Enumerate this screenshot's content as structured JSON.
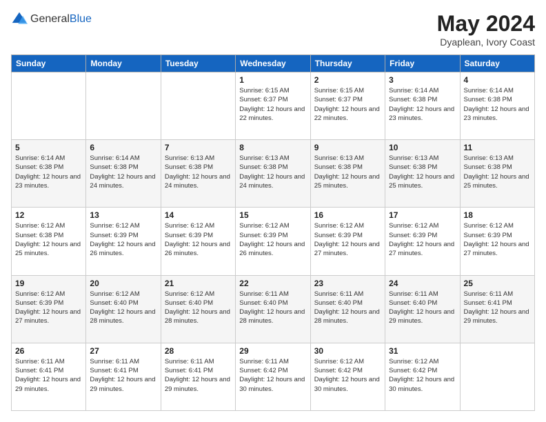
{
  "logo": {
    "general": "General",
    "blue": "Blue"
  },
  "header": {
    "title": "May 2024",
    "subtitle": "Dyaplean, Ivory Coast"
  },
  "weekdays": [
    "Sunday",
    "Monday",
    "Tuesday",
    "Wednesday",
    "Thursday",
    "Friday",
    "Saturday"
  ],
  "weeks": [
    [
      {
        "day": "",
        "info": ""
      },
      {
        "day": "",
        "info": ""
      },
      {
        "day": "",
        "info": ""
      },
      {
        "day": "1",
        "info": "Sunrise: 6:15 AM\nSunset: 6:37 PM\nDaylight: 12 hours and 22 minutes."
      },
      {
        "day": "2",
        "info": "Sunrise: 6:15 AM\nSunset: 6:37 PM\nDaylight: 12 hours and 22 minutes."
      },
      {
        "day": "3",
        "info": "Sunrise: 6:14 AM\nSunset: 6:38 PM\nDaylight: 12 hours and 23 minutes."
      },
      {
        "day": "4",
        "info": "Sunrise: 6:14 AM\nSunset: 6:38 PM\nDaylight: 12 hours and 23 minutes."
      }
    ],
    [
      {
        "day": "5",
        "info": "Sunrise: 6:14 AM\nSunset: 6:38 PM\nDaylight: 12 hours and 23 minutes."
      },
      {
        "day": "6",
        "info": "Sunrise: 6:14 AM\nSunset: 6:38 PM\nDaylight: 12 hours and 24 minutes."
      },
      {
        "day": "7",
        "info": "Sunrise: 6:13 AM\nSunset: 6:38 PM\nDaylight: 12 hours and 24 minutes."
      },
      {
        "day": "8",
        "info": "Sunrise: 6:13 AM\nSunset: 6:38 PM\nDaylight: 12 hours and 24 minutes."
      },
      {
        "day": "9",
        "info": "Sunrise: 6:13 AM\nSunset: 6:38 PM\nDaylight: 12 hours and 25 minutes."
      },
      {
        "day": "10",
        "info": "Sunrise: 6:13 AM\nSunset: 6:38 PM\nDaylight: 12 hours and 25 minutes."
      },
      {
        "day": "11",
        "info": "Sunrise: 6:13 AM\nSunset: 6:38 PM\nDaylight: 12 hours and 25 minutes."
      }
    ],
    [
      {
        "day": "12",
        "info": "Sunrise: 6:12 AM\nSunset: 6:38 PM\nDaylight: 12 hours and 25 minutes."
      },
      {
        "day": "13",
        "info": "Sunrise: 6:12 AM\nSunset: 6:39 PM\nDaylight: 12 hours and 26 minutes."
      },
      {
        "day": "14",
        "info": "Sunrise: 6:12 AM\nSunset: 6:39 PM\nDaylight: 12 hours and 26 minutes."
      },
      {
        "day": "15",
        "info": "Sunrise: 6:12 AM\nSunset: 6:39 PM\nDaylight: 12 hours and 26 minutes."
      },
      {
        "day": "16",
        "info": "Sunrise: 6:12 AM\nSunset: 6:39 PM\nDaylight: 12 hours and 27 minutes."
      },
      {
        "day": "17",
        "info": "Sunrise: 6:12 AM\nSunset: 6:39 PM\nDaylight: 12 hours and 27 minutes."
      },
      {
        "day": "18",
        "info": "Sunrise: 6:12 AM\nSunset: 6:39 PM\nDaylight: 12 hours and 27 minutes."
      }
    ],
    [
      {
        "day": "19",
        "info": "Sunrise: 6:12 AM\nSunset: 6:39 PM\nDaylight: 12 hours and 27 minutes."
      },
      {
        "day": "20",
        "info": "Sunrise: 6:12 AM\nSunset: 6:40 PM\nDaylight: 12 hours and 28 minutes."
      },
      {
        "day": "21",
        "info": "Sunrise: 6:12 AM\nSunset: 6:40 PM\nDaylight: 12 hours and 28 minutes."
      },
      {
        "day": "22",
        "info": "Sunrise: 6:11 AM\nSunset: 6:40 PM\nDaylight: 12 hours and 28 minutes."
      },
      {
        "day": "23",
        "info": "Sunrise: 6:11 AM\nSunset: 6:40 PM\nDaylight: 12 hours and 28 minutes."
      },
      {
        "day": "24",
        "info": "Sunrise: 6:11 AM\nSunset: 6:40 PM\nDaylight: 12 hours and 29 minutes."
      },
      {
        "day": "25",
        "info": "Sunrise: 6:11 AM\nSunset: 6:41 PM\nDaylight: 12 hours and 29 minutes."
      }
    ],
    [
      {
        "day": "26",
        "info": "Sunrise: 6:11 AM\nSunset: 6:41 PM\nDaylight: 12 hours and 29 minutes."
      },
      {
        "day": "27",
        "info": "Sunrise: 6:11 AM\nSunset: 6:41 PM\nDaylight: 12 hours and 29 minutes."
      },
      {
        "day": "28",
        "info": "Sunrise: 6:11 AM\nSunset: 6:41 PM\nDaylight: 12 hours and 29 minutes."
      },
      {
        "day": "29",
        "info": "Sunrise: 6:11 AM\nSunset: 6:42 PM\nDaylight: 12 hours and 30 minutes."
      },
      {
        "day": "30",
        "info": "Sunrise: 6:12 AM\nSunset: 6:42 PM\nDaylight: 12 hours and 30 minutes."
      },
      {
        "day": "31",
        "info": "Sunrise: 6:12 AM\nSunset: 6:42 PM\nDaylight: 12 hours and 30 minutes."
      },
      {
        "day": "",
        "info": ""
      }
    ]
  ]
}
